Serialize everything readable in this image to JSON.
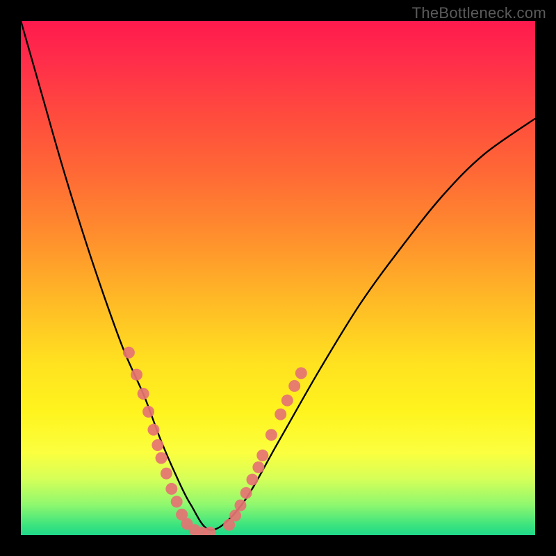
{
  "watermark": "TheBottleneck.com",
  "chart_data": {
    "type": "line",
    "title": "",
    "xlabel": "",
    "ylabel": "",
    "xlim": [
      0,
      1
    ],
    "ylim": [
      0,
      1
    ],
    "series": [
      {
        "name": "bottleneck-curve",
        "x": [
          0.0,
          0.04,
          0.08,
          0.12,
          0.16,
          0.2,
          0.24,
          0.27,
          0.3,
          0.33,
          0.37,
          0.43,
          0.5,
          0.58,
          0.66,
          0.74,
          0.82,
          0.9,
          1.0
        ],
        "y": [
          1.0,
          0.86,
          0.72,
          0.59,
          0.47,
          0.36,
          0.27,
          0.19,
          0.12,
          0.06,
          0.01,
          0.06,
          0.18,
          0.32,
          0.45,
          0.56,
          0.66,
          0.74,
          0.81
        ]
      }
    ],
    "markers": {
      "left_branch": [
        {
          "x": 0.21,
          "y": 0.355
        },
        {
          "x": 0.225,
          "y": 0.312
        },
        {
          "x": 0.238,
          "y": 0.275
        },
        {
          "x": 0.248,
          "y": 0.24
        },
        {
          "x": 0.258,
          "y": 0.205
        },
        {
          "x": 0.266,
          "y": 0.175
        },
        {
          "x": 0.273,
          "y": 0.15
        },
        {
          "x": 0.283,
          "y": 0.12
        },
        {
          "x": 0.293,
          "y": 0.09
        },
        {
          "x": 0.303,
          "y": 0.065
        },
        {
          "x": 0.313,
          "y": 0.04
        },
        {
          "x": 0.323,
          "y": 0.022
        },
        {
          "x": 0.338,
          "y": 0.01
        },
        {
          "x": 0.352,
          "y": 0.005
        },
        {
          "x": 0.368,
          "y": 0.005
        }
      ],
      "right_branch": [
        {
          "x": 0.405,
          "y": 0.02
        },
        {
          "x": 0.417,
          "y": 0.038
        },
        {
          "x": 0.427,
          "y": 0.058
        },
        {
          "x": 0.438,
          "y": 0.082
        },
        {
          "x": 0.45,
          "y": 0.108
        },
        {
          "x": 0.462,
          "y": 0.132
        },
        {
          "x": 0.47,
          "y": 0.155
        },
        {
          "x": 0.487,
          "y": 0.195
        },
        {
          "x": 0.505,
          "y": 0.235
        },
        {
          "x": 0.518,
          "y": 0.262
        },
        {
          "x": 0.532,
          "y": 0.29
        },
        {
          "x": 0.545,
          "y": 0.315
        }
      ]
    },
    "marker_color": "#e57373",
    "curve_color": "#000000"
  }
}
